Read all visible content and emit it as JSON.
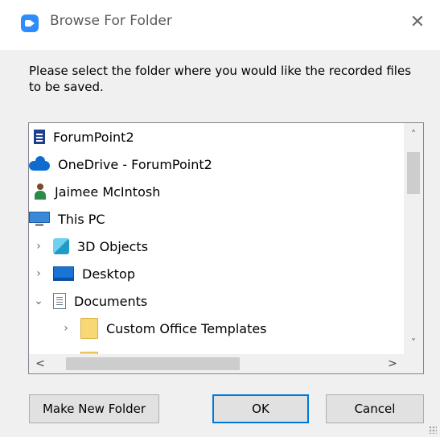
{
  "window": {
    "title": "Browse For Folder",
    "close_glyph": "✕"
  },
  "prompt": "Please select the folder where you would like the recorded files to be saved.",
  "tree": {
    "items": [
      {
        "label": "ForumPoint2",
        "icon": "building-icon",
        "expander": ""
      },
      {
        "label": "OneDrive - ForumPoint2",
        "icon": "onedrive-cloud-icon",
        "expander": ""
      },
      {
        "label": "Jaimee McIntosh",
        "icon": "user-icon",
        "expander": ""
      },
      {
        "label": "This PC",
        "icon": "computer-icon",
        "expander": ""
      },
      {
        "label": "3D Objects",
        "icon": "3d-objects-icon",
        "expander": "›"
      },
      {
        "label": "Desktop",
        "icon": "desktop-icon",
        "expander": "›"
      },
      {
        "label": "Documents",
        "icon": "documents-icon",
        "expander": "⌄"
      },
      {
        "label": "Custom Office Templates",
        "icon": "folder-icon",
        "expander": "›"
      }
    ]
  },
  "scroll": {
    "up": "˄",
    "down": "˅",
    "left": "<",
    "right": ">"
  },
  "buttons": {
    "new_folder": "Make New Folder",
    "ok": "OK",
    "cancel": "Cancel"
  }
}
